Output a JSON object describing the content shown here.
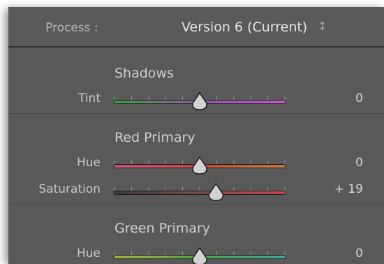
{
  "process": {
    "label": "Process :",
    "value": "Version 6 (Current)",
    "arrows": "↕"
  },
  "sections": [
    {
      "title": "Shadows",
      "rows": [
        {
          "label": "Tint",
          "value": "0",
          "level": 0.5,
          "gradient": [
            "#3f9b3f",
            "#8a5aa0",
            "#c05ac8"
          ]
        }
      ]
    },
    {
      "title": "Red Primary",
      "rows": [
        {
          "label": "Hue",
          "value": "0",
          "level": 0.5,
          "gradient": [
            "#c8507a",
            "#c04a3c",
            "#c07a3a"
          ]
        },
        {
          "label": "Saturation",
          "value": "+ 19",
          "level": 0.595,
          "gradient": [
            "#3a3a3a",
            "#7a4a4a",
            "#c84848"
          ]
        }
      ]
    },
    {
      "title": "Green Primary",
      "rows": [
        {
          "label": "Hue",
          "value": "0",
          "level": 0.5,
          "gradient": [
            "#a0b440",
            "#5aa050",
            "#40a898"
          ]
        }
      ]
    }
  ]
}
